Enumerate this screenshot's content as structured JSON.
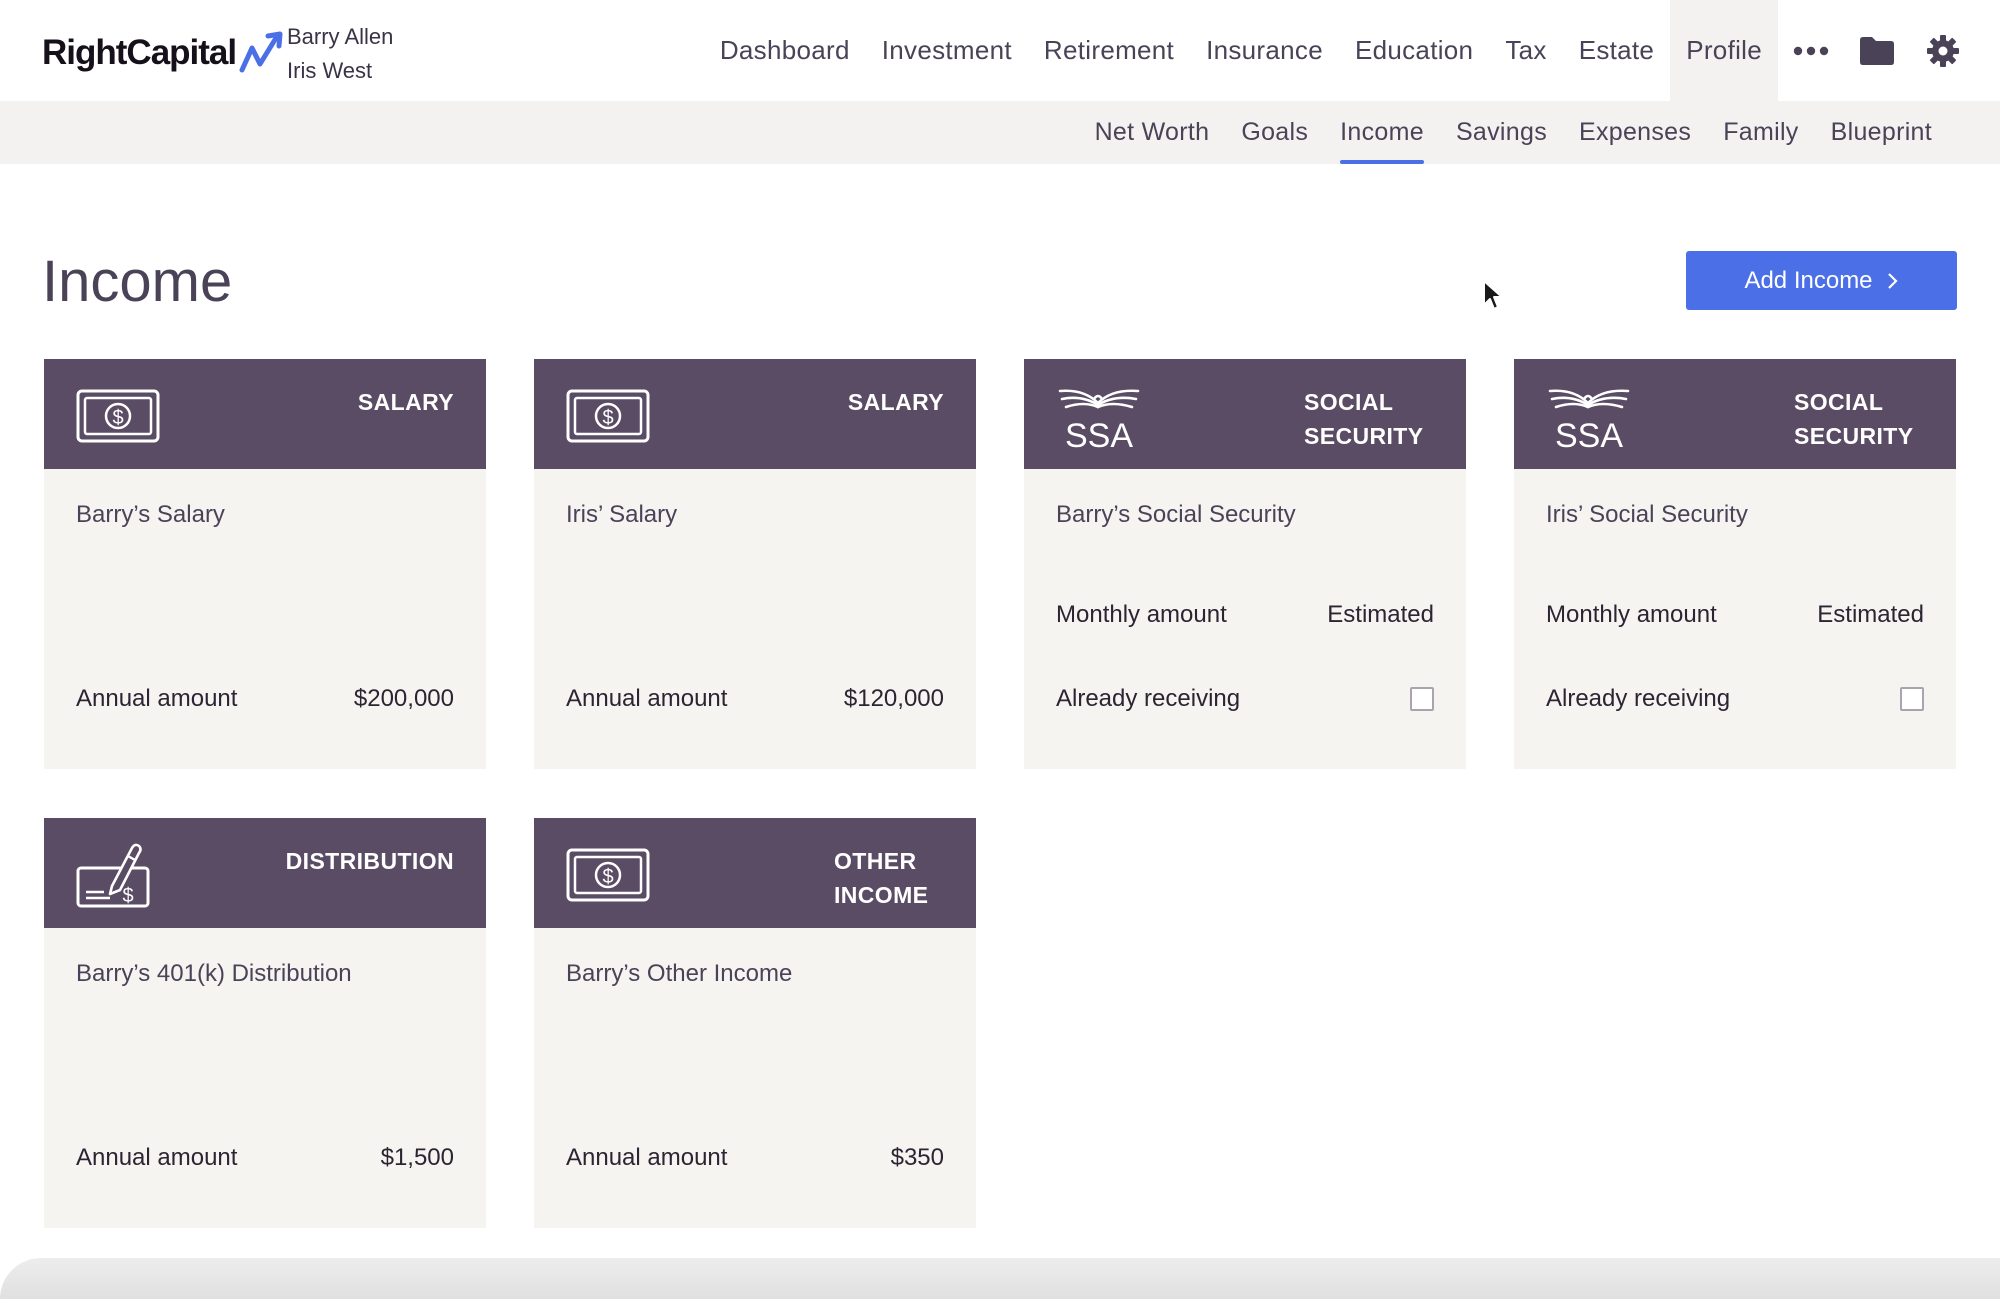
{
  "header": {
    "logo_text": "RightCapital",
    "clients": [
      "Barry Allen",
      "Iris West"
    ]
  },
  "main_nav": [
    {
      "label": "Dashboard",
      "active": false
    },
    {
      "label": "Investment",
      "active": false
    },
    {
      "label": "Retirement",
      "active": false
    },
    {
      "label": "Insurance",
      "active": false
    },
    {
      "label": "Education",
      "active": false
    },
    {
      "label": "Tax",
      "active": false
    },
    {
      "label": "Estate",
      "active": false
    },
    {
      "label": "Profile",
      "active": true
    }
  ],
  "nav_icons": [
    "more-icon",
    "folder-icon",
    "gear-icon"
  ],
  "sub_nav": [
    {
      "label": "Net Worth",
      "active": false
    },
    {
      "label": "Goals",
      "active": false
    },
    {
      "label": "Income",
      "active": true
    },
    {
      "label": "Savings",
      "active": false
    },
    {
      "label": "Expenses",
      "active": false
    },
    {
      "label": "Family",
      "active": false
    },
    {
      "label": "Blueprint",
      "active": false
    }
  ],
  "page": {
    "title": "Income",
    "add_button_label": "Add Income"
  },
  "cards": [
    {
      "type": "SALARY",
      "icon": "money-bill-icon",
      "name": "Barry’s Salary",
      "amount_label": "Annual amount",
      "amount": "$200,000"
    },
    {
      "type": "SALARY",
      "icon": "money-bill-icon",
      "name": "Iris’ Salary",
      "amount_label": "Annual amount",
      "amount": "$120,000"
    },
    {
      "type_lines": [
        "SOCIAL",
        "SECURITY"
      ],
      "icon": "ssa-eagle-icon",
      "logo_text": "SSA",
      "name": "Barry’s Social Security",
      "monthly_label": "Monthly amount",
      "monthly_value": "Estimated",
      "receiving_label": "Already receiving",
      "receiving": false
    },
    {
      "type_lines": [
        "SOCIAL",
        "SECURITY"
      ],
      "icon": "ssa-eagle-icon",
      "logo_text": "SSA",
      "name": "Iris’ Social Security",
      "monthly_label": "Monthly amount",
      "monthly_value": "Estimated",
      "receiving_label": "Already receiving",
      "receiving": false
    },
    {
      "type": "DISTRIBUTION",
      "icon": "check-pen-icon",
      "name": "Barry’s 401(k) Distribution",
      "amount_label": "Annual amount",
      "amount": "$1,500"
    },
    {
      "type_lines": [
        "OTHER",
        "INCOME"
      ],
      "icon": "money-bill-icon",
      "name": "Barry’s Other Income",
      "amount_label": "Annual amount",
      "amount": "$350"
    }
  ],
  "colors": {
    "card_header": "#5a4c64",
    "card_body": "#f6f4f1",
    "accent": "#4b6fe6",
    "subnav_bg": "#f3f2f0"
  }
}
